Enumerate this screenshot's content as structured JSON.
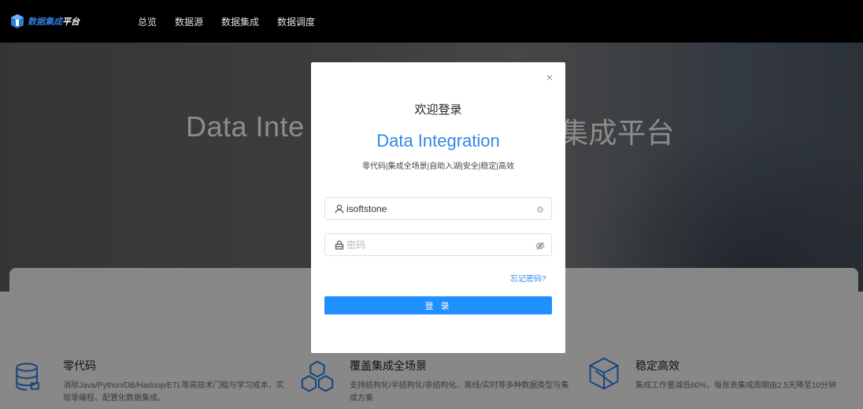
{
  "navbar": {
    "brand_prefix": "数据集成",
    "brand_suffix": "平台",
    "links": [
      "总览",
      "数据源",
      "数据集成",
      "数据调度"
    ]
  },
  "hero": {
    "title_left": "Data Inte",
    "title_right": "集成平台"
  },
  "features": [
    {
      "title": "零代码",
      "desc": "消除Java/Python/DB/Hadoop/ETL等高技术门槛与学习成本，实现零编程、配置化数据集成。",
      "icon": "database-icon"
    },
    {
      "title": "覆盖集成全场景",
      "desc": "支持结构化/半结构化/非结构化、离线/实时等多种数据类型与集成方案",
      "icon": "hexagons-icon"
    },
    {
      "title": "稳定高效",
      "desc": "集成工作量减低60%，每张表集成周期由2.5天降至10分钟",
      "icon": "cube-icon"
    }
  ],
  "modal": {
    "close_label": "×",
    "title": "欢迎登录",
    "brand": "Data Integration",
    "tagline": "零代码|集成全场景|自助入湖|安全|稳定|高效",
    "username_value": "isoftstone",
    "password_placeholder": "密码",
    "forgot_label": "忘记密码?",
    "login_label": "登 录"
  },
  "colors": {
    "accent": "#1e90ff",
    "link": "#2f89e5",
    "navbar": "#000000"
  }
}
